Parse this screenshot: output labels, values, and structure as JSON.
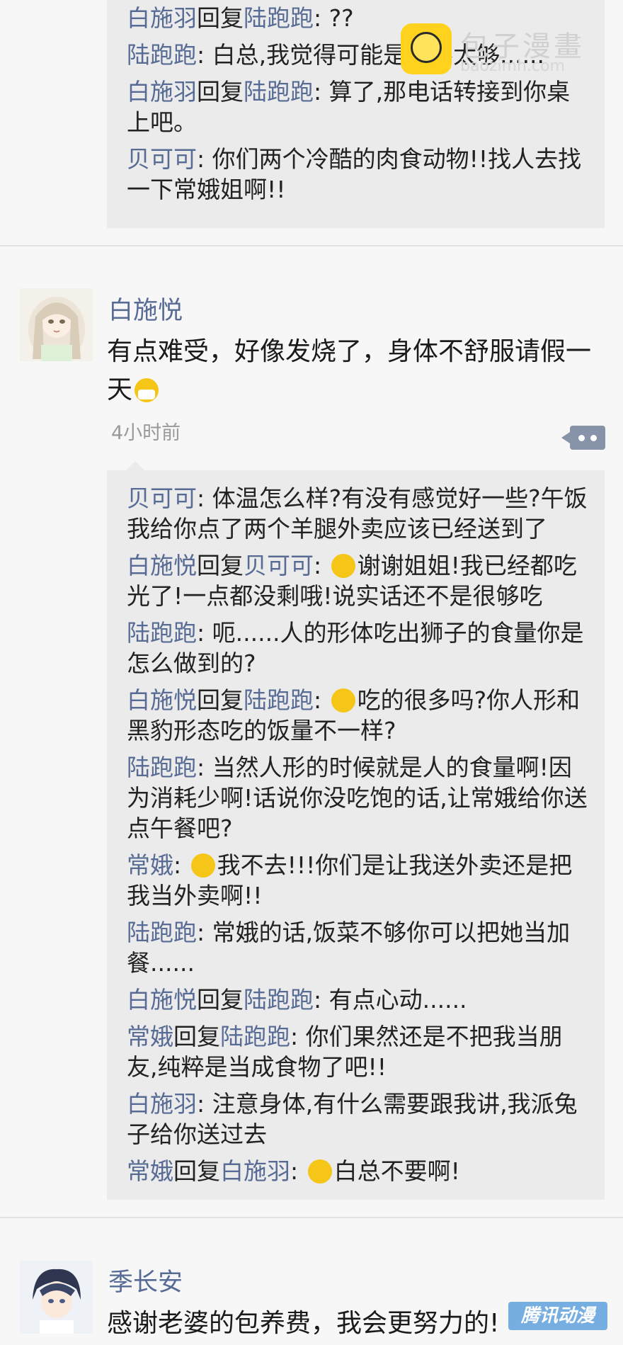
{
  "top_thread": {
    "replies": [
      {
        "name": "白施羽",
        "reply_word": "回复",
        "target": "陆跑跑",
        "text": ": ??"
      },
      {
        "name": "陆跑跑",
        "reply_word": "",
        "target": "",
        "text": ": 白总,我觉得可能是餐不太够......"
      },
      {
        "name": "白施羽",
        "reply_word": "回复",
        "target": "陆跑跑",
        "text": ": 算了,那电话转接到你桌上吧。"
      },
      {
        "name": "贝可可",
        "reply_word": "",
        "target": "",
        "text": ": 你们两个冷酷的肉食动物!!找人去找一下常娥姐啊!!"
      }
    ]
  },
  "post": {
    "username": "白施悦",
    "text": "有点难受，好像发烧了，身体不舒服请假一天",
    "emoji": "mask-emoji",
    "time": "4小时前",
    "replies": [
      {
        "name": "贝可可",
        "reply_word": "",
        "target": "",
        "emoji": "",
        "text": ": 体温怎么样?有没有感觉好一些?午饭我给你点了两个羊腿外卖应该已经送到了"
      },
      {
        "name": "白施悦",
        "reply_word": "回复",
        "target": "贝可可",
        "emoji": "tongue-emoji",
        "text": "谢谢姐姐!我已经都吃光了!一点都没剩哦!说实话还不是很够吃"
      },
      {
        "name": "陆跑跑",
        "reply_word": "",
        "target": "",
        "emoji": "",
        "text": ": 呃......人的形体吃出狮子的食量你是怎么做到的?"
      },
      {
        "name": "白施悦",
        "reply_word": "回复",
        "target": "陆跑跑",
        "emoji": "dizzy-emoji",
        "text": "吃的很多吗?你人形和黑豹形态吃的饭量不一样?"
      },
      {
        "name": "陆跑跑",
        "reply_word": "",
        "target": "",
        "emoji": "",
        "text": ": 当然人形的时候就是人的食量啊!因为消耗少啊!话说你没吃饱的话,让常娥给你送点午餐吧?"
      },
      {
        "name": "常娥",
        "reply_word": "",
        "target": "",
        "emoji": "cry-emoji",
        "text": "我不去!!!你们是让我送外卖还是把我当外卖啊!!"
      },
      {
        "name": "陆跑跑",
        "reply_word": "",
        "target": "",
        "emoji": "",
        "text": ": 常娥的话,饭菜不够你可以把她当加餐......"
      },
      {
        "name": "白施悦",
        "reply_word": "回复",
        "target": "陆跑跑",
        "emoji": "",
        "text": ": 有点心动......"
      },
      {
        "name": "常娥",
        "reply_word": "回复",
        "target": "陆跑跑",
        "emoji": "",
        "text": ": 你们果然还是不把我当朋友,纯粹是当成食物了吧!!"
      },
      {
        "name": "白施羽",
        "reply_word": "",
        "target": "",
        "emoji": "",
        "text": ": 注意身体,有什么需要跟我讲,我派兔子给你送过去"
      },
      {
        "name": "常娥",
        "reply_word": "回复",
        "target": "白施羽",
        "emoji": "tired-emoji",
        "text": "白总不要啊!"
      }
    ]
  },
  "post2": {
    "username": "季长安",
    "text": "感谢老婆的包养费，我会更努力的!"
  },
  "watermark": {
    "title": "包子漫畫",
    "sub": "baozimh.com"
  },
  "corner_logo": {
    "text": "腾讯动漫"
  },
  "colors": {
    "name_link": "#576b95",
    "reply_bg": "#ebebeb",
    "page_bg": "#f7f7f7",
    "more_button": "#8793a8"
  }
}
